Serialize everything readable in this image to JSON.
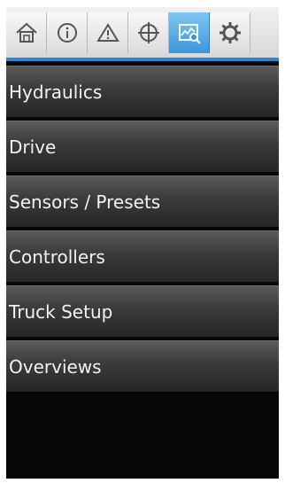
{
  "toolbar": {
    "tabs": [
      {
        "icon": "home-icon",
        "active": false
      },
      {
        "icon": "info-icon",
        "active": false
      },
      {
        "icon": "warning-icon",
        "active": false
      },
      {
        "icon": "crosshair-icon",
        "active": false
      },
      {
        "icon": "chart-search-icon",
        "active": true
      },
      {
        "icon": "gear-icon",
        "active": false
      }
    ],
    "accent_color": "#2d88d4"
  },
  "menu": {
    "items": [
      {
        "label": "Hydraulics"
      },
      {
        "label": "Drive"
      },
      {
        "label": "Sensors / Presets"
      },
      {
        "label": "Controllers"
      },
      {
        "label": "Truck Setup"
      },
      {
        "label": "Overviews"
      }
    ]
  }
}
